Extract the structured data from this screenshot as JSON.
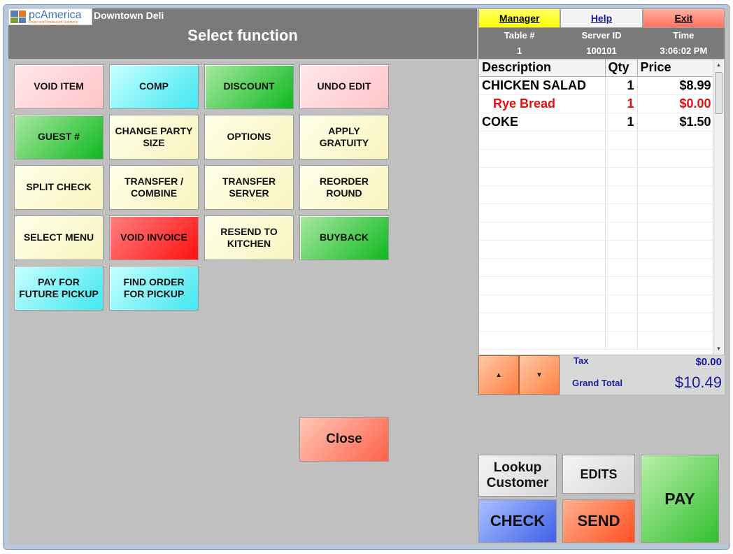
{
  "header": {
    "logo_name": "pcAmerica",
    "logo_tagline": "Retail and Restaurant Solutions",
    "store_name": "Downtown Deli",
    "title": "Select function"
  },
  "top_buttons": {
    "manager": "Manager",
    "help": "Help",
    "exit": "Exit"
  },
  "info": {
    "table_label": "Table #",
    "server_label": "Server ID",
    "time_label": "Time",
    "table_value": "1",
    "server_value": "100101",
    "time_value": "3:06:02 PM"
  },
  "functions": [
    {
      "label": "VOID ITEM",
      "color": "pink"
    },
    {
      "label": "COMP",
      "color": "cyan"
    },
    {
      "label": "DISCOUNT",
      "color": "green"
    },
    {
      "label": "UNDO EDIT",
      "color": "pink"
    },
    {
      "label": "GUEST #",
      "color": "green"
    },
    {
      "label": "CHANGE PARTY SIZE",
      "color": "yellow"
    },
    {
      "label": "OPTIONS",
      "color": "yellow"
    },
    {
      "label": "APPLY GRATUITY",
      "color": "yellow"
    },
    {
      "label": "SPLIT CHECK",
      "color": "yellow"
    },
    {
      "label": "TRANSFER / COMBINE",
      "color": "yellow"
    },
    {
      "label": "TRANSFER SERVER",
      "color": "yellow"
    },
    {
      "label": "REORDER ROUND",
      "color": "yellow"
    },
    {
      "label": "SELECT MENU",
      "color": "yellow"
    },
    {
      "label": "VOID INVOICE",
      "color": "red"
    },
    {
      "label": "RESEND TO KITCHEN",
      "color": "yellow"
    },
    {
      "label": "BUYBACK",
      "color": "green"
    },
    {
      "label": "PAY FOR FUTURE PICKUP",
      "color": "cyan"
    },
    {
      "label": "FIND ORDER FOR PICKUP",
      "color": "cyan"
    }
  ],
  "close_label": "Close",
  "order": {
    "headers": [
      "Description",
      "Qty",
      "Price"
    ],
    "rows": [
      {
        "desc": "CHICKEN SALAD",
        "qty": "1",
        "price": "$8.99",
        "modifier": false
      },
      {
        "desc": "Rye Bread",
        "qty": "1",
        "price": "$0.00",
        "modifier": true
      },
      {
        "desc": "COKE",
        "qty": "1",
        "price": "$1.50",
        "modifier": false
      }
    ],
    "empty_rows": 12
  },
  "totals": {
    "tax_label": "Tax",
    "tax_value": "$0.00",
    "grand_total_label": "Grand Total",
    "grand_total_value": "$10.49"
  },
  "actions": {
    "lookup": "Lookup Customer",
    "edits": "EDITS",
    "pay": "PAY",
    "check": "CHECK",
    "send": "SEND"
  },
  "colors": {
    "pink": "c-pink",
    "cyan": "c-cyan",
    "green": "c-green",
    "yellow": "c-yellow",
    "red": "c-red"
  }
}
